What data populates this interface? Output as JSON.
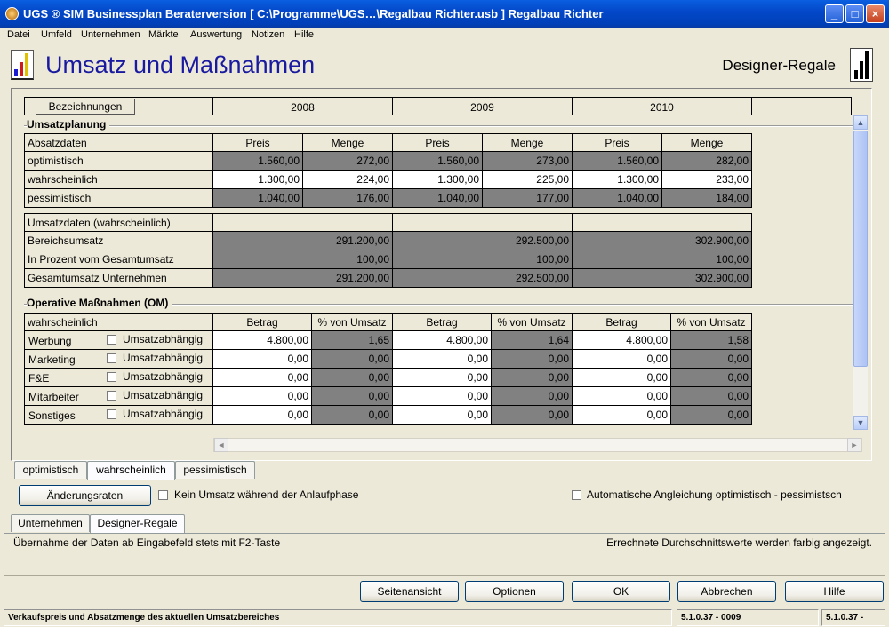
{
  "window": {
    "title": "UGS ® SIM Businessplan Beraterversion   [ C:\\Programme\\UGS…\\Regalbau Richter.usb ] Regalbau Richter"
  },
  "menu": [
    "Datei",
    "Umfeld",
    "Unternehmen",
    "Märkte",
    "Auswertung",
    "Notizen",
    "Hilfe"
  ],
  "header": {
    "title": "Umsatz und Maßnahmen",
    "firm": "Designer-Regale"
  },
  "years": {
    "btn": "Bezeichnungen",
    "y1": "2008",
    "y2": "2009",
    "y3": "2010"
  },
  "umsatzplanung": {
    "group": "Umsatzplanung",
    "head": {
      "label": "Absatzdaten",
      "preis": "Preis",
      "menge": "Menge"
    },
    "rows": [
      {
        "label": "optimistisch",
        "v": [
          "1.560,00",
          "272,00",
          "1.560,00",
          "273,00",
          "1.560,00",
          "282,00"
        ]
      },
      {
        "label": "wahrscheinlich",
        "v": [
          "1.300,00",
          "224,00",
          "1.300,00",
          "225,00",
          "1.300,00",
          "233,00"
        ]
      },
      {
        "label": "pessimistisch",
        "v": [
          "1.040,00",
          "176,00",
          "1.040,00",
          "177,00",
          "1.040,00",
          "184,00"
        ]
      }
    ],
    "sumhead": "Umsatzdaten (wahrscheinlich)",
    "sums": [
      {
        "label": "Bereichsumsatz",
        "v": [
          "291.200,00",
          "292.500,00",
          "302.900,00"
        ]
      },
      {
        "label": "In Prozent vom Gesamtumsatz",
        "v": [
          "100,00",
          "100,00",
          "100,00"
        ]
      },
      {
        "label": "Gesamtumsatz Unternehmen",
        "v": [
          "291.200,00",
          "292.500,00",
          "302.900,00"
        ]
      }
    ]
  },
  "om": {
    "group": "Operative Maßnahmen (OM)",
    "head": {
      "label": "wahrscheinlich",
      "betrag": "Betrag",
      "pct": "% von Umsatz"
    },
    "cb_label": "Umsatzabhängig",
    "rows": [
      {
        "label": "Werbung",
        "v": [
          "4.800,00",
          "1,65",
          "4.800,00",
          "1,64",
          "4.800,00",
          "1,58"
        ]
      },
      {
        "label": "Marketing",
        "v": [
          "0,00",
          "0,00",
          "0,00",
          "0,00",
          "0,00",
          "0,00"
        ]
      },
      {
        "label": "F&E",
        "v": [
          "0,00",
          "0,00",
          "0,00",
          "0,00",
          "0,00",
          "0,00"
        ]
      },
      {
        "label": "Mitarbeiter",
        "v": [
          "0,00",
          "0,00",
          "0,00",
          "0,00",
          "0,00",
          "0,00"
        ]
      },
      {
        "label": "Sonstiges",
        "v": [
          "0,00",
          "0,00",
          "0,00",
          "0,00",
          "0,00",
          "0,00"
        ]
      }
    ]
  },
  "scenario_tabs": [
    "optimistisch",
    "wahrscheinlich",
    "pessimistisch"
  ],
  "aenderungsraten": "Änderungsraten",
  "kein_umsatz": "Kein Umsatz während der Anlaufphase",
  "auto_angleich": "Automatische Angleichung optimistisch - pessimistsch",
  "section_tabs": [
    "Unternehmen",
    "Designer-Regale"
  ],
  "info_left": "Übernahme der Daten ab Eingabefeld stets mit F2-Taste",
  "info_right": "Errechnete Durchschnittswerte werden farbig angezeigt.",
  "buttons": {
    "seitenansicht": "Seitenansicht",
    "optionen": "Optionen",
    "ok": "OK",
    "abbrechen": "Abbrechen",
    "hilfe": "Hilfe"
  },
  "status": {
    "text": "Verkaufspreis und Absatzmenge des aktuellen Umsatzbereiches",
    "v1": "5.1.0.37 - 0009",
    "v2": "5.1.0.37 -"
  }
}
